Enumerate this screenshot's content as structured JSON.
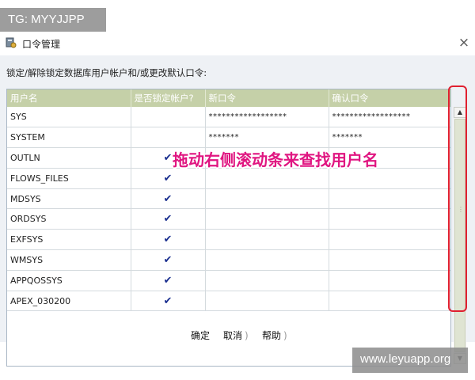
{
  "watermarks": {
    "top": "TG: MYYJJPP",
    "bottom": "www.leyuapp.org"
  },
  "window": {
    "title": "口令管理",
    "close_glyph": "×"
  },
  "instruction": "锁定/解除锁定数据库用户帐户和/或更改默认口令:",
  "table": {
    "columns": [
      "用户名",
      "是否锁定帐户?",
      "新口令",
      "确认口令"
    ],
    "rows": [
      {
        "user": "SYS",
        "locked": false,
        "new_pwd": "******************",
        "confirm_pwd": "******************"
      },
      {
        "user": "SYSTEM",
        "locked": false,
        "new_pwd": "*******",
        "confirm_pwd": "*******"
      },
      {
        "user": "OUTLN",
        "locked": true,
        "new_pwd": "",
        "confirm_pwd": ""
      },
      {
        "user": "FLOWS_FILES",
        "locked": true,
        "new_pwd": "",
        "confirm_pwd": ""
      },
      {
        "user": "MDSYS",
        "locked": true,
        "new_pwd": "",
        "confirm_pwd": ""
      },
      {
        "user": "ORDSYS",
        "locked": true,
        "new_pwd": "",
        "confirm_pwd": ""
      },
      {
        "user": "EXFSYS",
        "locked": true,
        "new_pwd": "",
        "confirm_pwd": ""
      },
      {
        "user": "WMSYS",
        "locked": true,
        "new_pwd": "",
        "confirm_pwd": ""
      },
      {
        "user": "APPQOSSYS",
        "locked": true,
        "new_pwd": "",
        "confirm_pwd": ""
      },
      {
        "user": "APEX_030200",
        "locked": true,
        "new_pwd": "",
        "confirm_pwd": ""
      }
    ],
    "check_glyph": "✔"
  },
  "annotation": "拖动右侧滚动条来查找用户名",
  "buttons": {
    "ok": "确定",
    "cancel": "取消",
    "help": "帮助",
    "bracket": ")"
  },
  "colors": {
    "header_bg": "#c5d0a8",
    "check": "#1a2f8f",
    "annotation": "#e01681",
    "highlight": "#e02030"
  },
  "icons": {
    "title": "key-lock-icon",
    "scroll_up": "arrow-up-icon",
    "scroll_down": "arrow-down-icon"
  }
}
